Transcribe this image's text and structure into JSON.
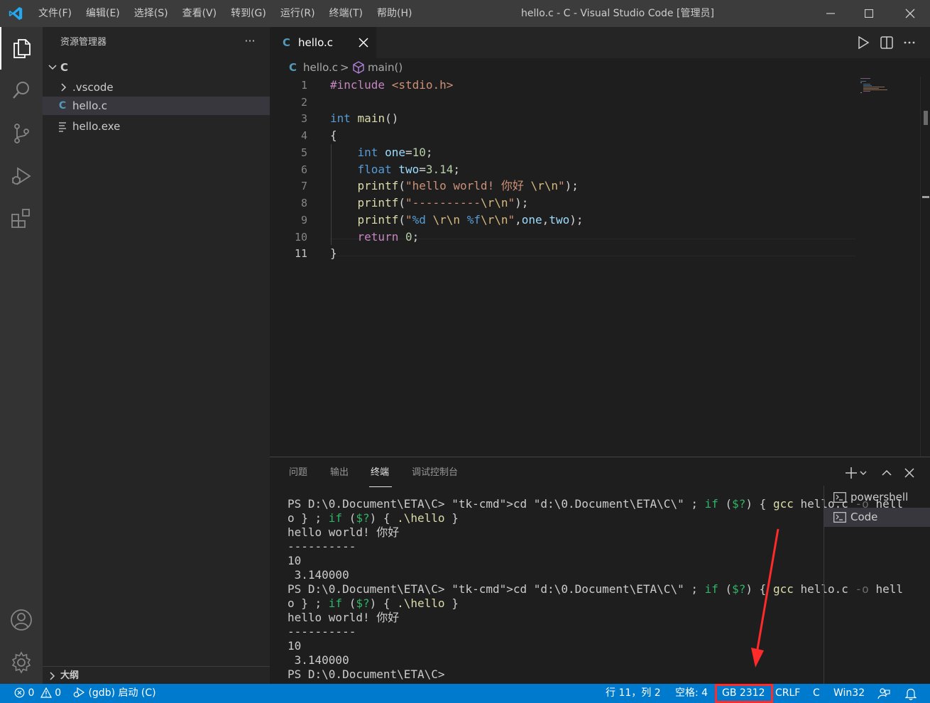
{
  "titlebar": {
    "menu": [
      "文件(F)",
      "编辑(E)",
      "选择(S)",
      "查看(V)",
      "转到(G)",
      "运行(R)",
      "终端(T)",
      "帮助(H)"
    ],
    "window_title": "hello.c - C - Visual Studio Code [管理员]"
  },
  "activity_icons": [
    "explorer-icon",
    "search-icon",
    "source-control-icon",
    "run-debug-icon",
    "extensions-icon",
    "account-icon",
    "manage-gear-icon"
  ],
  "sidebar": {
    "title": "资源管理器",
    "more": "···",
    "folder": "C",
    "items": [
      {
        "label": ".vscode",
        "type": "folder"
      },
      {
        "label": "hello.c",
        "type": "c-file",
        "icon_text": "C"
      },
      {
        "label": "hello.exe",
        "type": "exe-file"
      }
    ],
    "outline": "大纲"
  },
  "editor": {
    "tab": {
      "label": "hello.c",
      "icon_text": "C"
    },
    "breadcrumb": {
      "file_icon": "C",
      "file": "hello.c",
      "separator": ">",
      "symbol": "main()"
    },
    "line_numbers": [
      "1",
      "2",
      "3",
      "4",
      "5",
      "6",
      "7",
      "8",
      "9",
      "10",
      "11"
    ],
    "code": [
      "#include <stdio.h>",
      "",
      "int main()",
      "{",
      "    int one=10;",
      "    float two=3.14;",
      "    printf(\"hello world! 你好 \\r\\n\");",
      "    printf(\"----------\\r\\n\");",
      "    printf(\"%d \\r\\n %f\\r\\n\",one,two);",
      "    return 0;",
      "}"
    ],
    "current_line": 11
  },
  "panel": {
    "tabs": [
      "问题",
      "输出",
      "终端",
      "调试控制台"
    ],
    "active_tab": "终端",
    "terminal_lines": [
      "PS D:\\0.Document\\ETA\\C> cd \"d:\\0.Document\\ETA\\C\\\" ; if ($?) { gcc hello.c -o hell",
      "o } ; if ($?) { .\\hello }",
      "hello world! 你好",
      "----------",
      "10",
      " 3.140000",
      "PS D:\\0.Document\\ETA\\C> cd \"d:\\0.Document\\ETA\\C\\\" ; if ($?) { gcc hello.c -o hell",
      "o } ; if ($?) { .\\hello }",
      "hello world! 你好",
      "----------",
      "10",
      " 3.140000",
      "PS D:\\0.Document\\ETA\\C>"
    ],
    "terminals": [
      {
        "name": "powershell",
        "selected": false
      },
      {
        "name": "Code",
        "selected": true
      }
    ]
  },
  "statusbar": {
    "errors": "0",
    "warnings": "0",
    "debug": "(gdb) 启动 (C)",
    "position": "行 11，列 2",
    "indent": "空格: 4",
    "encoding": "GB 2312",
    "eol": "CRLF",
    "language": "C",
    "config": "Win32"
  },
  "colors": {
    "titlebar": "#3c3c3c",
    "activitybar": "#333333",
    "sidebar": "#252526",
    "editor": "#1e1e1e",
    "statusbar": "#007acc",
    "highlight": "#ff2a2a"
  }
}
